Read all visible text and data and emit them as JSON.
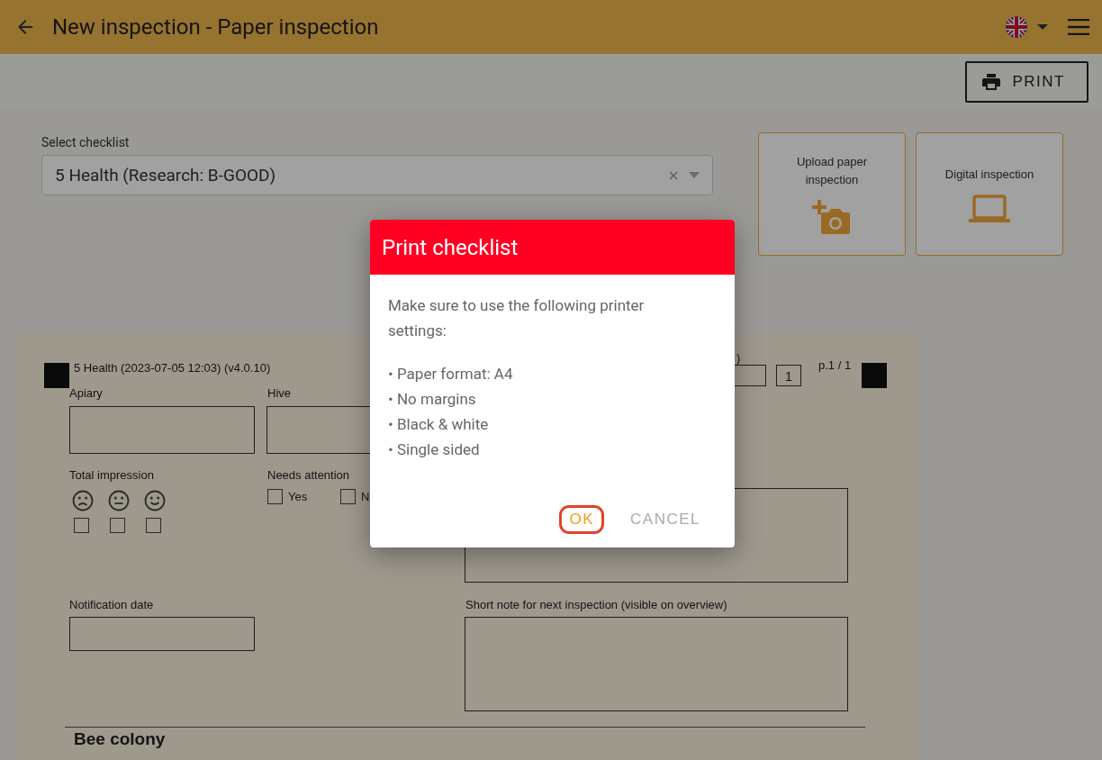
{
  "app_bar": {
    "title": "New inspection - Paper inspection"
  },
  "toolbar": {
    "print_button": "PRINT"
  },
  "checklist_select": {
    "label": "Select checklist",
    "value": "5 Health (Research: B-GOOD)"
  },
  "mode_cards": [
    {
      "label": "Upload paper inspection",
      "kind": "camera"
    },
    {
      "label": "Digital inspection",
      "kind": "laptop"
    }
  ],
  "paper_sheet": {
    "title": "5 Health (2023-07-05 12:03) (v4.0.10)",
    "label_fragment": ")",
    "page_count_box": "1",
    "page": "p.1 / 1",
    "apiary_label": "Apiary",
    "hive_label": "Hive",
    "total_impression": {
      "label": "Total impression",
      "options": [
        {
          "kind": "sad",
          "checked": false
        },
        {
          "kind": "neutral",
          "checked": false
        },
        {
          "kind": "happy",
          "checked": false
        }
      ]
    },
    "needs_attention": {
      "label": "Needs attention",
      "options": [
        {
          "label": "Yes",
          "checked": false
        },
        {
          "label": "N",
          "checked": false
        }
      ]
    },
    "notification_date_label": "Notification date",
    "short_note_label": "Short note for next inspection (visible on overview)",
    "section_heading": "Bee colony"
  },
  "dialog": {
    "title": "Print checklist",
    "intro": "Make sure to use the following printer settings:",
    "settings": [
      "• Paper format: A4",
      "• No margins",
      "• Black & white",
      "• Single sided"
    ],
    "buttons": [
      {
        "label": "OK",
        "kind": "primary",
        "focused": true
      },
      {
        "label": "CANCEL",
        "kind": "secondary",
        "focused": false
      }
    ]
  }
}
